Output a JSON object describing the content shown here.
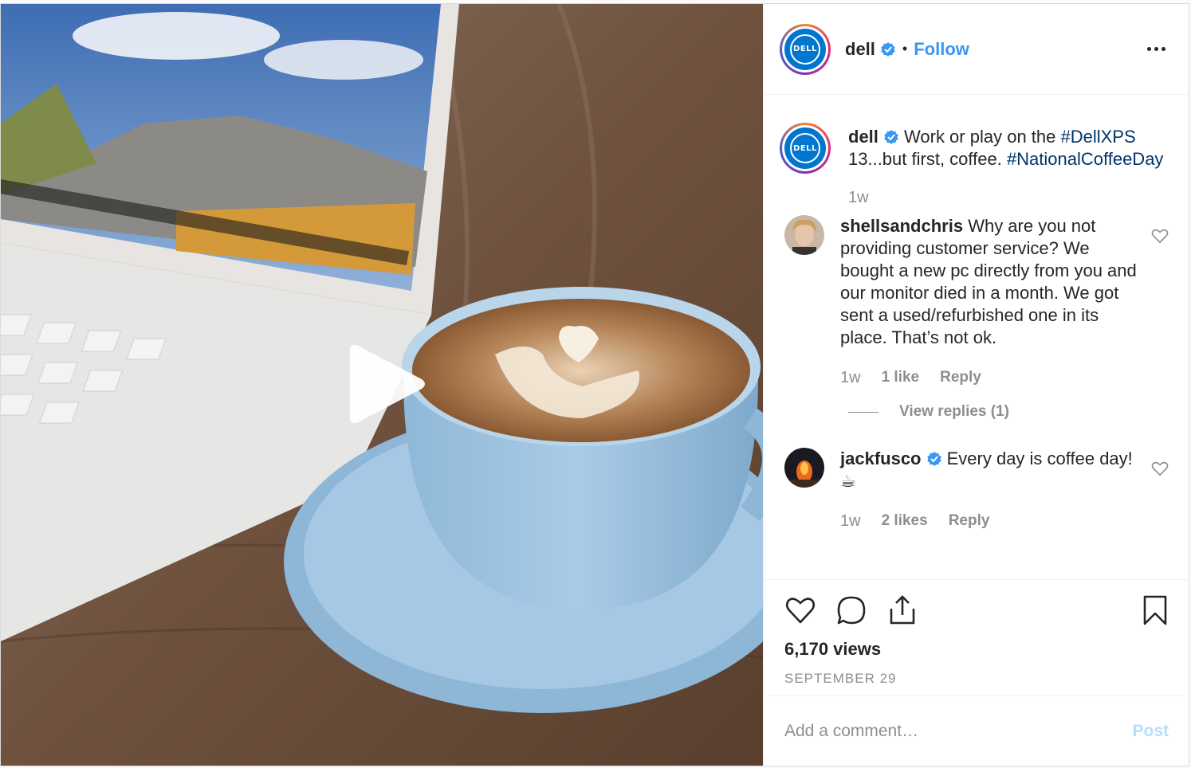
{
  "header": {
    "username": "dell",
    "separator": "•",
    "follow_label": "Follow",
    "logo_text": "DELL"
  },
  "caption": {
    "username": "dell",
    "text_before": " Work or play on the ",
    "hashtag1": "#DellXPS",
    "text_middle": " 13...but first, coffee. ",
    "hashtag2": "#NationalCoffeeDay",
    "time": "1w"
  },
  "comments": [
    {
      "username": "shellsandchris",
      "text": " Why are you not providing customer service? We bought a new pc directly from you and our monitor died in a month. We got sent a used/refurbished one in its place. That’s not ok.",
      "time": "1w",
      "likes": "1 like",
      "reply_label": "Reply",
      "view_replies": "View replies (1)"
    },
    {
      "username": "jackfusco",
      "text": " Every day is coffee day! ☕",
      "time": "1w",
      "likes": "2 likes",
      "reply_label": "Reply"
    }
  ],
  "stats": {
    "views": "6,170 views",
    "date": "SEPTEMBER 29"
  },
  "add_comment": {
    "placeholder": "Add a comment…",
    "post_label": "Post"
  },
  "colors": {
    "link_blue": "#3897f0",
    "hashtag": "#003569",
    "muted": "#8e8e8e",
    "post_disabled": "#b2dffc",
    "dell_blue": "#0076ce"
  }
}
